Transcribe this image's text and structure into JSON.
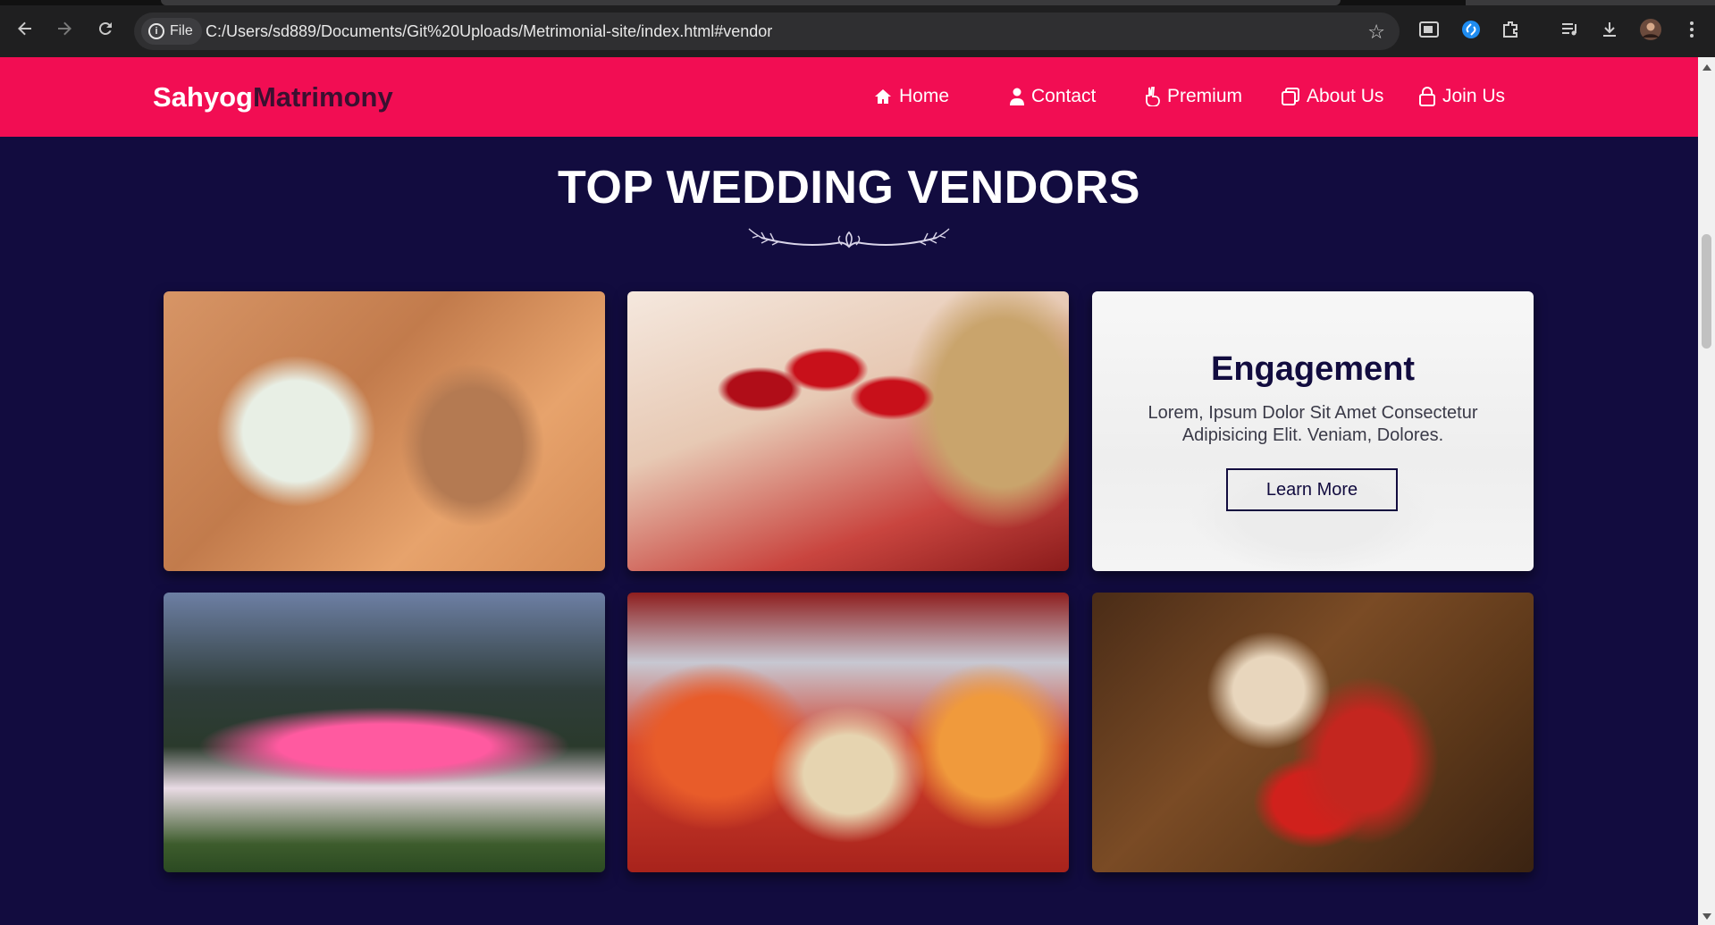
{
  "browser": {
    "file_chip": "File",
    "url": "C:/Users/sd889/Documents/Git%20Uploads/Metrimonial-site/index.html#vendor"
  },
  "brand": {
    "part1": "Sahyog",
    "part2": "Matrimony"
  },
  "nav": {
    "items": [
      {
        "label": "Home",
        "icon": "home-icon"
      },
      {
        "label": "Contact",
        "icon": "user-icon"
      },
      {
        "label": "Premium",
        "icon": "peace-hand-icon"
      },
      {
        "label": "About Us",
        "icon": "copy-icon"
      },
      {
        "label": "Join Us",
        "icon": "lock-icon"
      }
    ]
  },
  "section": {
    "title": "TOP WEDDING VENDORS"
  },
  "featured_card": {
    "title": "Engagement",
    "text": "Lorem, Ipsum Dolor Sit Amet Consectetur Adipisicing Elit. Veniam, Dolores.",
    "button": "Learn More"
  },
  "colors": {
    "header": "#f20d53",
    "background": "#120c3f",
    "brand_secondary": "#3a1030"
  }
}
